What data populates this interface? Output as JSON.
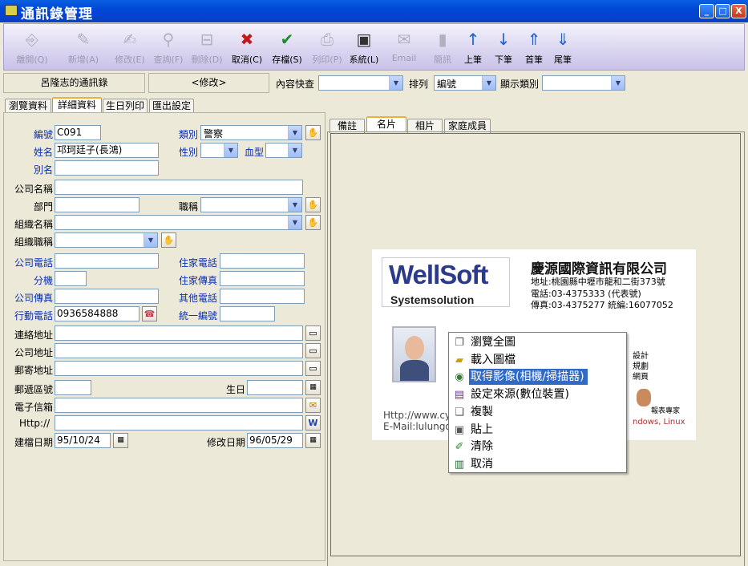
{
  "window": {
    "title": "通訊錄管理",
    "min": "_",
    "max": "□",
    "close": "X"
  },
  "toolbar": [
    {
      "label": "離開(Q)",
      "icon": "exit-icon",
      "glyph": "⎆",
      "enabled": false
    },
    {
      "label": "新增(A)",
      "icon": "new-icon",
      "glyph": "✎",
      "enabled": false
    },
    {
      "label": "修改(E)",
      "icon": "edit-icon",
      "glyph": "✍",
      "enabled": false
    },
    {
      "label": "查詢(F)",
      "icon": "search-icon",
      "glyph": "⚲",
      "enabled": false
    },
    {
      "label": "刪除(D)",
      "icon": "delete-icon",
      "glyph": "⊟",
      "enabled": false
    },
    {
      "label": "取消(C)",
      "icon": "cancel-icon",
      "glyph": "✖",
      "enabled": true
    },
    {
      "label": "存檔(S)",
      "icon": "save-icon",
      "glyph": "✔",
      "enabled": true
    },
    {
      "label": "列印(P)",
      "icon": "print-icon",
      "glyph": "⎙",
      "enabled": false
    },
    {
      "label": "系統(L)",
      "icon": "system-icon",
      "glyph": "▣",
      "enabled": true
    },
    {
      "label": "Email",
      "icon": "email-icon",
      "glyph": "✉",
      "enabled": false
    },
    {
      "label": "簡訊",
      "icon": "sms-icon",
      "glyph": "▮",
      "enabled": false
    },
    {
      "label": "上筆",
      "icon": "arrow-up-icon",
      "glyph": "↑",
      "enabled": true
    },
    {
      "label": "下筆",
      "icon": "arrow-down-icon",
      "glyph": "↓",
      "enabled": true
    },
    {
      "label": "首筆",
      "icon": "arrow-first-icon",
      "glyph": "⇑",
      "enabled": true
    },
    {
      "label": "尾筆",
      "icon": "arrow-last-icon",
      "glyph": "⇓",
      "enabled": true
    }
  ],
  "info": {
    "book": "呂隆志的通訊錄",
    "mode": "<修改>",
    "quick_label": "內容快查",
    "quick_value": "",
    "sort_label": "排列",
    "sort_value": "編號",
    "cat_label": "顯示類別",
    "cat_value": ""
  },
  "tabs": [
    "瀏覽資料",
    "詳細資料",
    "生日列印",
    "匯出設定"
  ],
  "form": {
    "no_label": "編號",
    "no": "C091",
    "category_label": "類別",
    "category": "警察",
    "name_label": "姓名",
    "name": "邛珂廷子(長鴻)",
    "gender_label": "性別",
    "gender": "",
    "blood_label": "血型",
    "blood": "",
    "alias_label": "別名",
    "alias": "",
    "company_label": "公司名稱",
    "company": "",
    "dept_label": "部門",
    "dept": "",
    "title_label": "職稱",
    "title": "",
    "org_label": "組織名稱",
    "org": "",
    "orgtitle_label": "組織職稱",
    "orgtitle": "",
    "cphone_label": "公司電話",
    "cphone": "",
    "hphone_label": "住家電話",
    "hphone": "",
    "ext_label": "分機",
    "ext": "",
    "hfax_label": "住家傳真",
    "hfax": "",
    "cfax_label": "公司傳真",
    "cfax": "",
    "other_label": "其他電話",
    "other": "",
    "mobile_label": "行動電話",
    "mobile": "0936584888",
    "taxid_label": "統一編號",
    "taxid": "",
    "contact_label": "連絡地址",
    "contact": "",
    "caddr_label": "公司地址",
    "caddr": "",
    "mail_label": "郵寄地址",
    "mail": "",
    "zip_label": "郵遞區號",
    "zip": "",
    "bday_label": "生日",
    "bday": "",
    "email_label": "電子信箱",
    "email": "",
    "http_label": "Http://",
    "http": "",
    "created_label": "建檔日期",
    "created": "95/10/24",
    "modified_label": "修改日期",
    "modified": "96/05/29"
  },
  "right_tabs": [
    "備註",
    "名片",
    "相片",
    "家庭成員"
  ],
  "card": {
    "logo_top": "WellSoft",
    "logo_bottom": "Systemsolution",
    "company": "慶源國際資訊有限公司",
    "addr": "地址:桃園縣中壢市龍和二街373號",
    "tel": "電話:03-4375333 (代表號)",
    "fax": "傳真:03-4375277   統編:16077052",
    "side1": "設計",
    "side2": "規劃",
    "side3": "網頁",
    "http": "Http://www.cyn",
    "email": "E-Mail:lulungo",
    "expert": "報表專家",
    "os": "ndows, Linux"
  },
  "context_menu": [
    {
      "label": "瀏覽全圖",
      "icon": "view-icon",
      "glyph": "❐"
    },
    {
      "label": "載入圖檔",
      "icon": "open-folder-icon",
      "glyph": "▰"
    },
    {
      "label": "取得影像(相機/掃描器)",
      "icon": "scanner-icon",
      "glyph": "◉"
    },
    {
      "label": "設定來源(數位裝置)",
      "icon": "device-icon",
      "glyph": "▤"
    },
    {
      "label": "複製",
      "icon": "copy-icon",
      "glyph": "❏"
    },
    {
      "label": "貼上",
      "icon": "paste-icon",
      "glyph": "▣"
    },
    {
      "label": "清除",
      "icon": "clear-icon",
      "glyph": "✐"
    },
    {
      "label": "取消",
      "icon": "cancel-icon",
      "glyph": "▥"
    }
  ]
}
